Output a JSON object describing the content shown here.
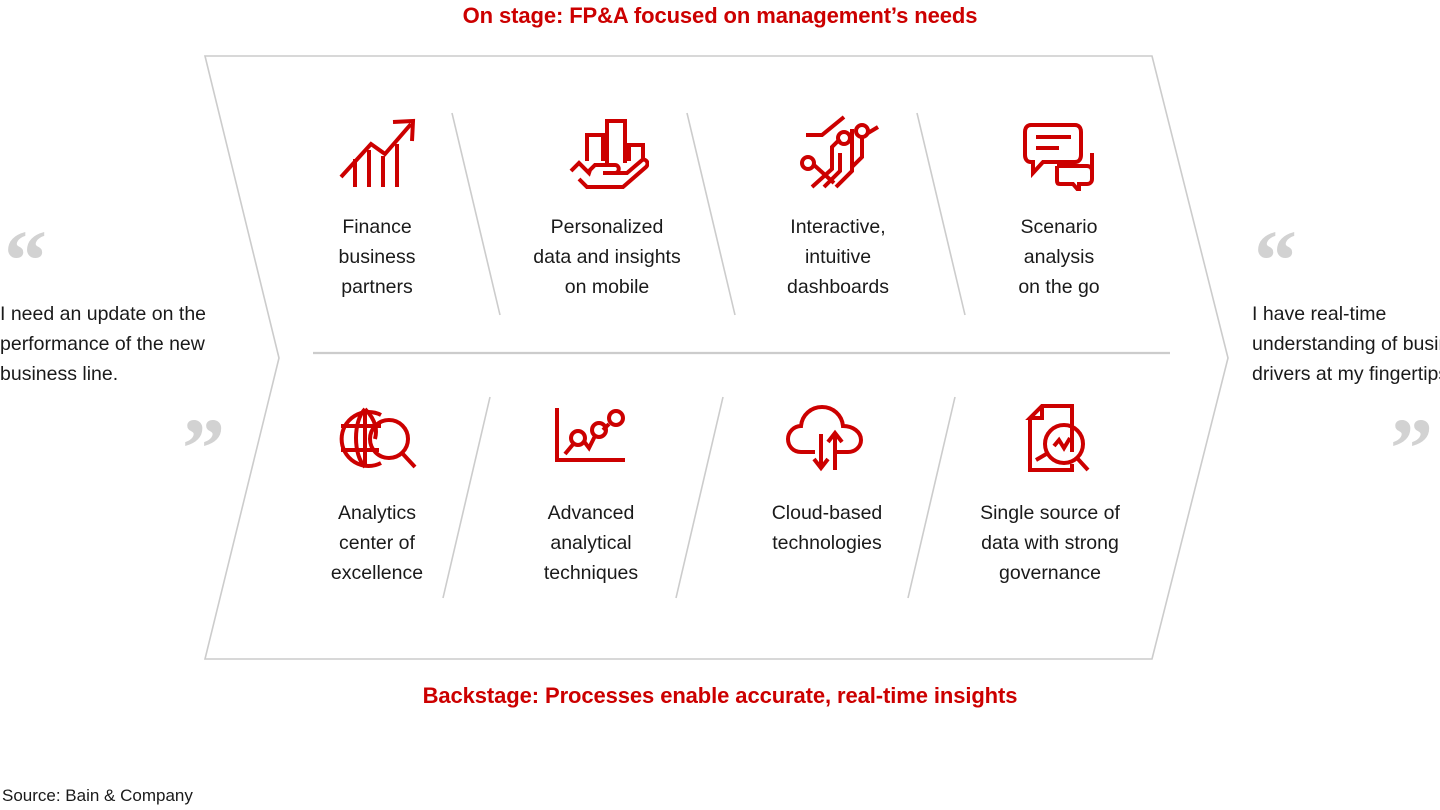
{
  "titles": {
    "top": "On stage: FP&A focused on management’s needs",
    "bottom": "Backstage: Processes enable accurate, real-time insights"
  },
  "colors": {
    "accent_red": "#CC0000",
    "outline_gray": "#CCCCCC",
    "quote_mark_gray": "#D2D2D2",
    "text_black": "#1A1A1A",
    "background": "#FFFFFF"
  },
  "quotes": {
    "left": {
      "text": "I need an update on the performance of the new business line.",
      "open_mark": "“",
      "close_mark": "”"
    },
    "right": {
      "text": "I have real-time understanding of business drivers at my fingertips.",
      "open_mark": "“",
      "close_mark": "”"
    }
  },
  "rows": {
    "top": {
      "name": "on-stage",
      "cells": [
        {
          "label": "Finance\nbusiness\npartners",
          "icon": "growth-chart-arrow-icon"
        },
        {
          "label": "Personalized\ndata and insights\non mobile",
          "icon": "hand-holding-bar-chart-icon"
        },
        {
          "label": "Interactive,\nintuitive\ndashboards",
          "icon": "circuit-network-icon"
        },
        {
          "label": "Scenario\nanalysis\non the go",
          "icon": "speech-bubbles-icon"
        }
      ]
    },
    "bottom": {
      "name": "backstage",
      "cells": [
        {
          "label": "Analytics\ncenter of\nexcellence",
          "icon": "globe-magnifier-icon"
        },
        {
          "label": "Advanced\nanalytical\ntechniques",
          "icon": "line-chart-points-icon"
        },
        {
          "label": "Cloud-based\ntechnologies",
          "icon": "cloud-sync-arrows-icon"
        },
        {
          "label": "Single source of\ndata with strong\ngovernance",
          "icon": "document-magnifier-icon"
        }
      ]
    }
  },
  "source": "Source: Bain & Company"
}
